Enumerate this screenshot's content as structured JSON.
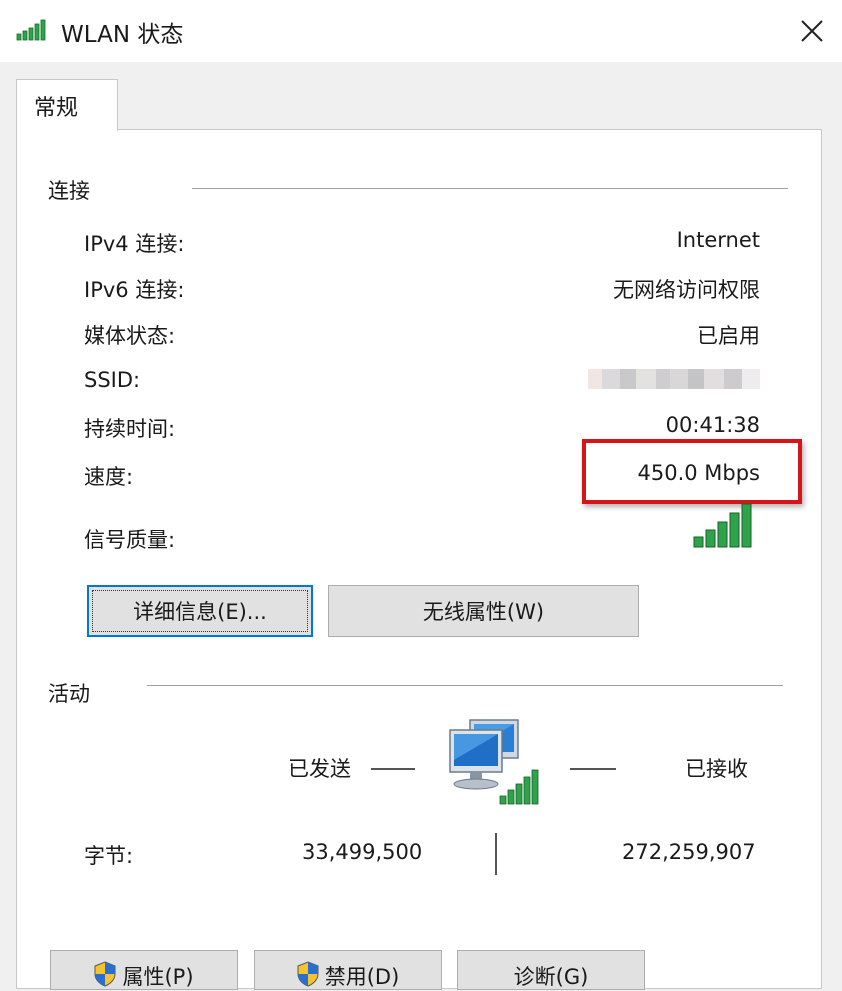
{
  "window": {
    "title": "WLAN 状态",
    "icon": "wifi-signal-icon",
    "close_icon": "close-icon"
  },
  "tabs": [
    {
      "label": "常规",
      "selected": true
    }
  ],
  "connection": {
    "group_label": "连接",
    "rows": [
      {
        "label": "IPv4 连接:",
        "value": "Internet"
      },
      {
        "label": "IPv6 连接:",
        "value": "无网络访问权限"
      },
      {
        "label": "媒体状态:",
        "value": "已启用"
      },
      {
        "label": "SSID:",
        "value": ""
      },
      {
        "label": "持续时间:",
        "value": "00:41:38"
      },
      {
        "label": "速度:",
        "value": "450.0 Mbps"
      },
      {
        "label": "信号质量:",
        "value": ""
      }
    ],
    "signal_quality_bars": 5,
    "highlight_color": "#d4161b"
  },
  "buttons": {
    "details": "详细信息(E)...",
    "wireless_properties": "无线属性(W)"
  },
  "activity": {
    "group_label": "活动",
    "sent_label": "已发送",
    "received_label": "已接收",
    "bytes_label": "字节:",
    "bytes_sent": "33,499,500",
    "bytes_received": "272,259,907"
  },
  "bottom_buttons": {
    "properties": "属性(P)",
    "disable": "禁用(D)",
    "diagnose": "诊断(G)"
  },
  "colors": {
    "accent": "#0078d7",
    "signal_green": "#2fa34a"
  }
}
